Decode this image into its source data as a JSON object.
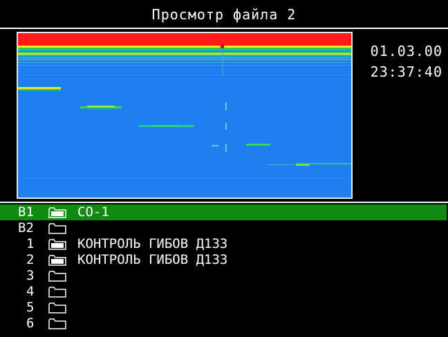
{
  "header": {
    "title": "Просмотр файла  2"
  },
  "datetime": {
    "date": "01.03.00",
    "time": "23:37:40"
  },
  "colors": {
    "selection": "#118a11",
    "spectro_bg": "#1e7ff0",
    "top_band": "#ff1a1a",
    "trace": "#33dd44"
  },
  "files": [
    {
      "index": "В1",
      "icon": "folder-filled-icon",
      "label": "СО-1",
      "selected": true
    },
    {
      "index": "В2",
      "icon": "folder-empty-icon",
      "label": ""
    },
    {
      "index": "1",
      "icon": "folder-filled-icon",
      "label": "КОНТРОЛЬ ГИБОВ Д133"
    },
    {
      "index": "2",
      "icon": "folder-filled-icon",
      "label": "КОНТРОЛЬ ГИБОВ Д133"
    },
    {
      "index": "3",
      "icon": "folder-empty-icon",
      "label": ""
    },
    {
      "index": "4",
      "icon": "folder-empty-icon",
      "label": ""
    },
    {
      "index": "5",
      "icon": "folder-empty-icon",
      "label": ""
    },
    {
      "index": "6",
      "icon": "folder-empty-icon",
      "label": ""
    }
  ]
}
